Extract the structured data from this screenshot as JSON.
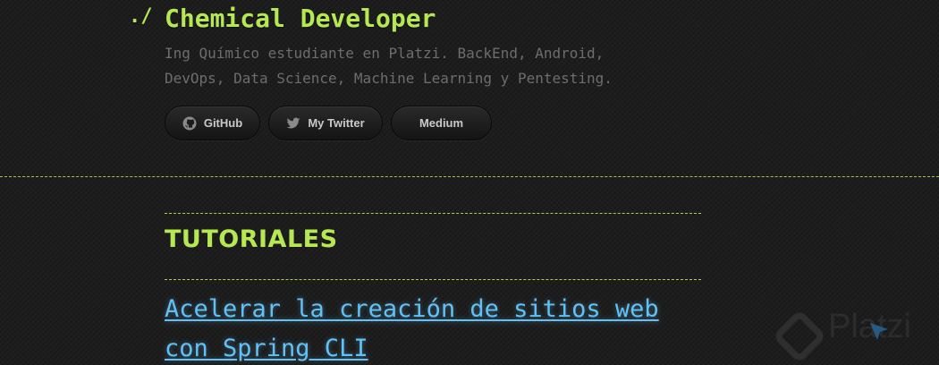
{
  "header": {
    "prompt": "./",
    "title": "Chemical Developer",
    "tagline": "Ing Químico estudiante en Platzi. BackEnd, Android, DevOps, Data Science, Machine Learning y Pentesting."
  },
  "social": {
    "github_label": "GitHub",
    "twitter_label": "My Twitter",
    "medium_label": "Medium",
    "github_icon": "github-icon",
    "twitter_icon": "twitter-icon"
  },
  "main": {
    "section_title": "TUTORIALES",
    "posts": [
      {
        "title": "Acelerar la creación de sitios web con Spring CLI"
      }
    ]
  },
  "watermark": {
    "brand": "Platzi"
  },
  "colors": {
    "accent_green": "#b5e853",
    "link_blue": "#63c0f5",
    "background": "#1d1d1d",
    "muted_text": "#6d6d6d"
  }
}
